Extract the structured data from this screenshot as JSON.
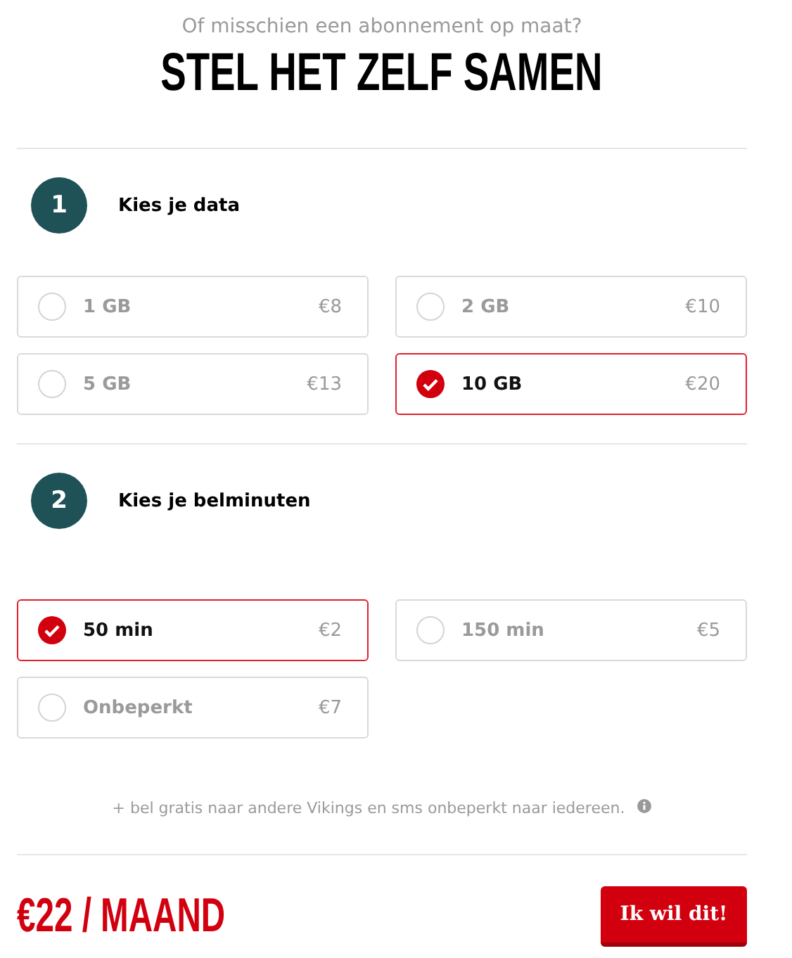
{
  "intro": "Of misschien een abonnement op maat?",
  "title": "STEL HET ZELF SAMEN",
  "steps": [
    {
      "number": "1",
      "label": "Kies je data",
      "options": [
        {
          "label": "1 GB",
          "price": "€8",
          "selected": false
        },
        {
          "label": "2 GB",
          "price": "€10",
          "selected": false
        },
        {
          "label": "5 GB",
          "price": "€13",
          "selected": false
        },
        {
          "label": "10 GB",
          "price": "€20",
          "selected": true
        }
      ]
    },
    {
      "number": "2",
      "label": "Kies je belminuten",
      "options": [
        {
          "label": "50 min",
          "price": "€2",
          "selected": true
        },
        {
          "label": "150 min",
          "price": "€5",
          "selected": false
        },
        {
          "label": "Onbeperkt",
          "price": "€7",
          "selected": false
        }
      ]
    }
  ],
  "note": "+ bel gratis naar andere Vikings en sms onbeperkt naar iedereen.",
  "total": "€22 / MAAND",
  "button": "Ik wil dit!"
}
